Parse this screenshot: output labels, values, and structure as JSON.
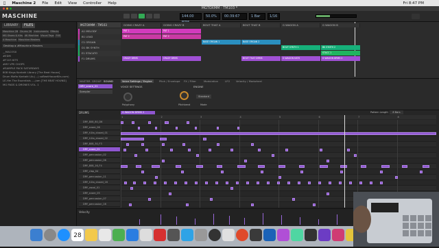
{
  "menubar": {
    "app": "Maschine 2",
    "items": [
      "File",
      "Edit",
      "View",
      "Controller",
      "Help"
    ],
    "clock": "Fri 8:47 PM"
  },
  "window": {
    "title": "MGTOXMM · TM103 *"
  },
  "header": {
    "logo": "MASCHINE",
    "tempo": "144.00",
    "bpm_label": "BPM",
    "swing": "50.0%",
    "position": "00:39:67",
    "bars": "1 Bar",
    "grid": "1/16"
  },
  "browser": {
    "tabs": [
      "LIBRARY",
      "FILES"
    ],
    "tags": [
      "Maschine 2B",
      "Drums 2K",
      "Instruments",
      "Effects",
      "MG Shoes & Kits",
      "4K Machine",
      "Visual Tags",
      "FXS",
      "4 Maschine",
      "Maschine Masters"
    ],
    "location": "Desktop",
    "breadcrumb": "#Maschine Masters",
    "folders": [
      "__MACOSX",
      "#EDM",
      "#F103 KITS",
      "#MY VPS CHOPS",
      "#SAMPLE PACK SATURDAYS",
      "808 Kings Kontakt Library [The Beat House]",
      "Drum Mafia Kontakt Lib-(...) soBeatHouseKits.com)",
      "LE-Hm The Essentials -...(am [THE BEAT HOUND]",
      "MG PADS & DRONES VOL. 1"
    ]
  },
  "arranger": {
    "project": "MGTOXMM - TM103",
    "scenes": [
      "GOING CRAZY A",
      "GOING CRAZY B",
      "BOUT THAT A",
      "BOUT THAT B",
      "G WAGON A",
      "G WAGON B"
    ],
    "groups": [
      {
        "id": "A1",
        "name": "MELODY",
        "color": "#d23bbd"
      },
      {
        "id": "B1",
        "name": "LEAD",
        "color": "#c93aa4"
      },
      {
        "id": "C1",
        "name": "ORGAN",
        "color": "#2a8fc0"
      },
      {
        "id": "D1",
        "name": "BK SYNTH",
        "color": "#16b07a"
      },
      {
        "id": "E1",
        "name": "STACATO",
        "color": "#20b460"
      },
      {
        "id": "F1",
        "name": "DRUMS",
        "color": "#a050d5"
      }
    ],
    "patterns": [
      {
        "row": 0,
        "scene": 0,
        "label": "PAT 1"
      },
      {
        "row": 0,
        "scene": 1,
        "label": "PAT 1"
      },
      {
        "row": 1,
        "scene": 0,
        "label": "PAT 2"
      },
      {
        "row": 1,
        "scene": 1,
        "label": "PAT 2"
      },
      {
        "row": 2,
        "scene": 2,
        "label": "BASE ORGAN 1"
      },
      {
        "row": 2,
        "scene": 3,
        "label": "BASE ORGAN 2"
      },
      {
        "row": 3,
        "scene": 4,
        "label": "BOUT SYNTH 1"
      },
      {
        "row": 3,
        "scene": 5,
        "label": "BK SYNTH 2"
      },
      {
        "row": 4,
        "scene": 5,
        "label": "STACC 1"
      },
      {
        "row": 5,
        "scene": 0,
        "label": "CRAZY DRMS"
      },
      {
        "row": 5,
        "scene": 1,
        "label": "CRAZY DRMS"
      },
      {
        "row": 5,
        "scene": 3,
        "label": "BOUT THAT DRMS"
      },
      {
        "row": 5,
        "scene": 4,
        "label": "G WAGON HATS"
      },
      {
        "row": 5,
        "scene": 5,
        "label": "G WAGON DRMS 2"
      }
    ]
  },
  "control": {
    "tabs": [
      "MASTER",
      "GROUP",
      "SOUND"
    ],
    "pagetabs": [
      "Voice Settings / Engine",
      "Pitch / Envelope",
      "FX / Filter",
      "Modulation",
      "LFO",
      "Velocity / Modwheel"
    ],
    "section1": "VOICE SETTINGS",
    "section2": "ENGINE",
    "slot": "DRY_snare_01",
    "plugin": "Sampler",
    "knobs": [
      "Polyphony",
      "Pitchbend",
      "Mode"
    ],
    "mode_value": "Standard"
  },
  "sequencer": {
    "group": "DRUMS",
    "pattern": "G WAGON DRMS 2",
    "pattern_length_label": "Pattern Length",
    "pattern_length": "8 Bars",
    "bars": [
      "1",
      "2",
      "3",
      "4",
      "5",
      "6",
      "7",
      "8"
    ],
    "sounds": [
      "DRY_808_80_D6",
      "DRY_snare_06",
      "DRY_h1ta_closed_01",
      "DRY_h1ta_closed_02",
      "DRY_808_30_F3",
      "DRY_snare_01",
      "DRY_percussion_02",
      "DRY_percussion_06",
      "DRY_808_16_F4",
      "DRY_clap_04",
      "DRY_percussion_11",
      "DRY_h1ta_closed_16",
      "DRY_vocal_01",
      "DRY_snare_05",
      "DRY_percussion_07",
      "DRY_percussion_16"
    ]
  },
  "velocity": {
    "label": "Velocity"
  },
  "dock": {
    "date": "28"
  }
}
